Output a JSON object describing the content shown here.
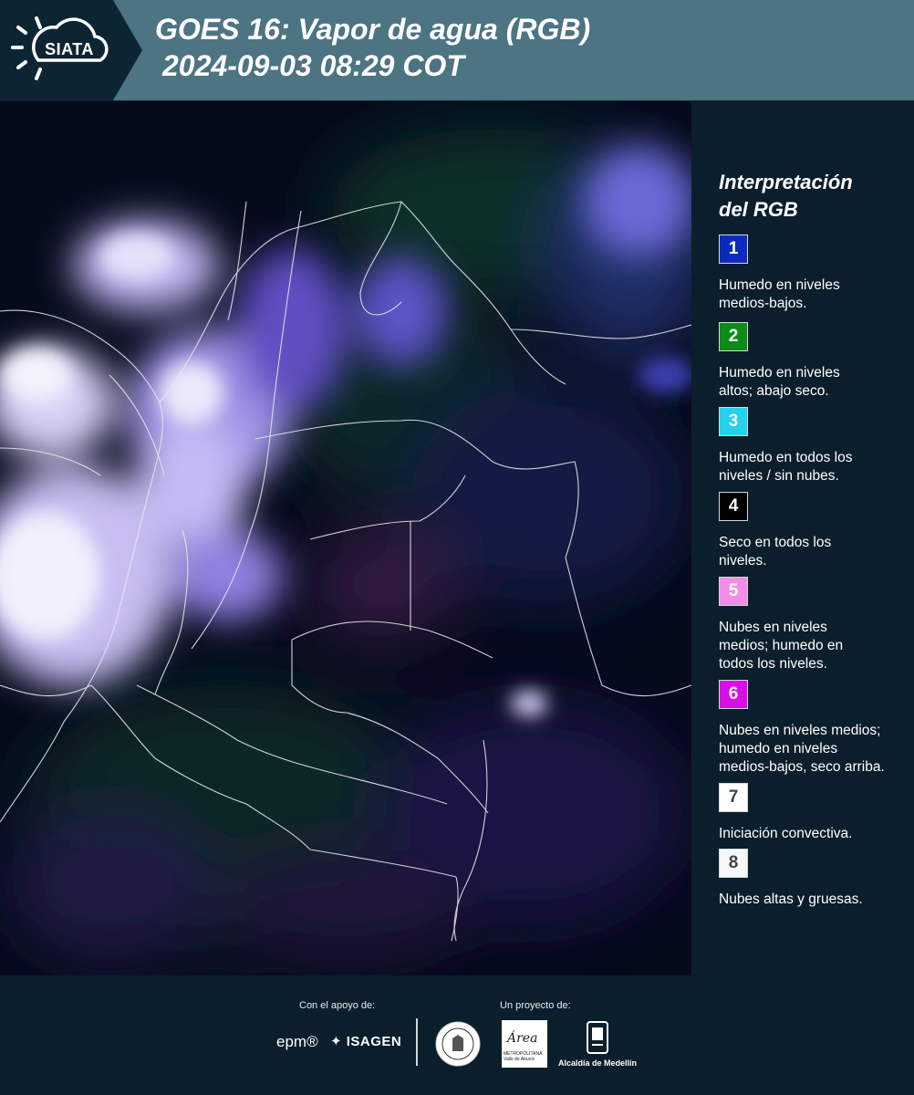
{
  "header": {
    "logo_text": "SIATA",
    "title_line1": "GOES 16: Vapor de agua (RGB)",
    "title_line2": "2024-09-03 08:29 COT"
  },
  "legend": {
    "title_line1": "Interpretación",
    "title_line2": "del RGB",
    "items": [
      {
        "number": "1",
        "color": "#0b2bbf",
        "text_color": "#ffffff",
        "line1": "Humedo en niveles",
        "line2": "medios-bajos.",
        "line3": ""
      },
      {
        "number": "2",
        "color": "#0c8c17",
        "text_color": "#ffffff",
        "line1": "Humedo en niveles",
        "line2": "altos; abajo seco.",
        "line3": ""
      },
      {
        "number": "3",
        "color": "#22d3ee",
        "text_color": "#ffffff",
        "line1": "Humedo en todos los",
        "line2": "niveles / sin nubes.",
        "line3": ""
      },
      {
        "number": "4",
        "color": "#000000",
        "text_color": "#ffffff",
        "line1": "Seco en todos los",
        "line2": "niveles.",
        "line3": ""
      },
      {
        "number": "5",
        "color": "#f48de8",
        "text_color": "#ffffff",
        "line1": "Nubes en niveles",
        "line2": "medios; humedo en",
        "line3": "todos los niveles."
      },
      {
        "number": "6",
        "color": "#d90ee6",
        "text_color": "#ffffff",
        "line1": "Nubes en niveles medios;",
        "line2": "humedo en niveles",
        "line3": "medios-bajos, seco arriba."
      },
      {
        "number": "7",
        "color": "#ffffff",
        "text_color": "#444444",
        "line1": "Iniciación convectiva.",
        "line2": "",
        "line3": ""
      },
      {
        "number": "8",
        "color": "#f7f7f7",
        "text_color": "#444444",
        "line1": "Nubes altas y gruesas.",
        "line2": "",
        "line3": ""
      }
    ]
  },
  "footer": {
    "support_label": "Con el apoyo de:",
    "project_label": "Un proyecto de:",
    "epm_logo": "epm®",
    "isagen_logo": "ISAGEN",
    "area_logo": "Área",
    "area_logo_sub": "METROPOLITANA Valle de Aburrá",
    "medellin_logo": "Alcaldía de Medellín"
  },
  "colors": {
    "header_bg": "#4c7483",
    "panel_bg": "#0b1e2b",
    "map_base": "#060b1c"
  }
}
